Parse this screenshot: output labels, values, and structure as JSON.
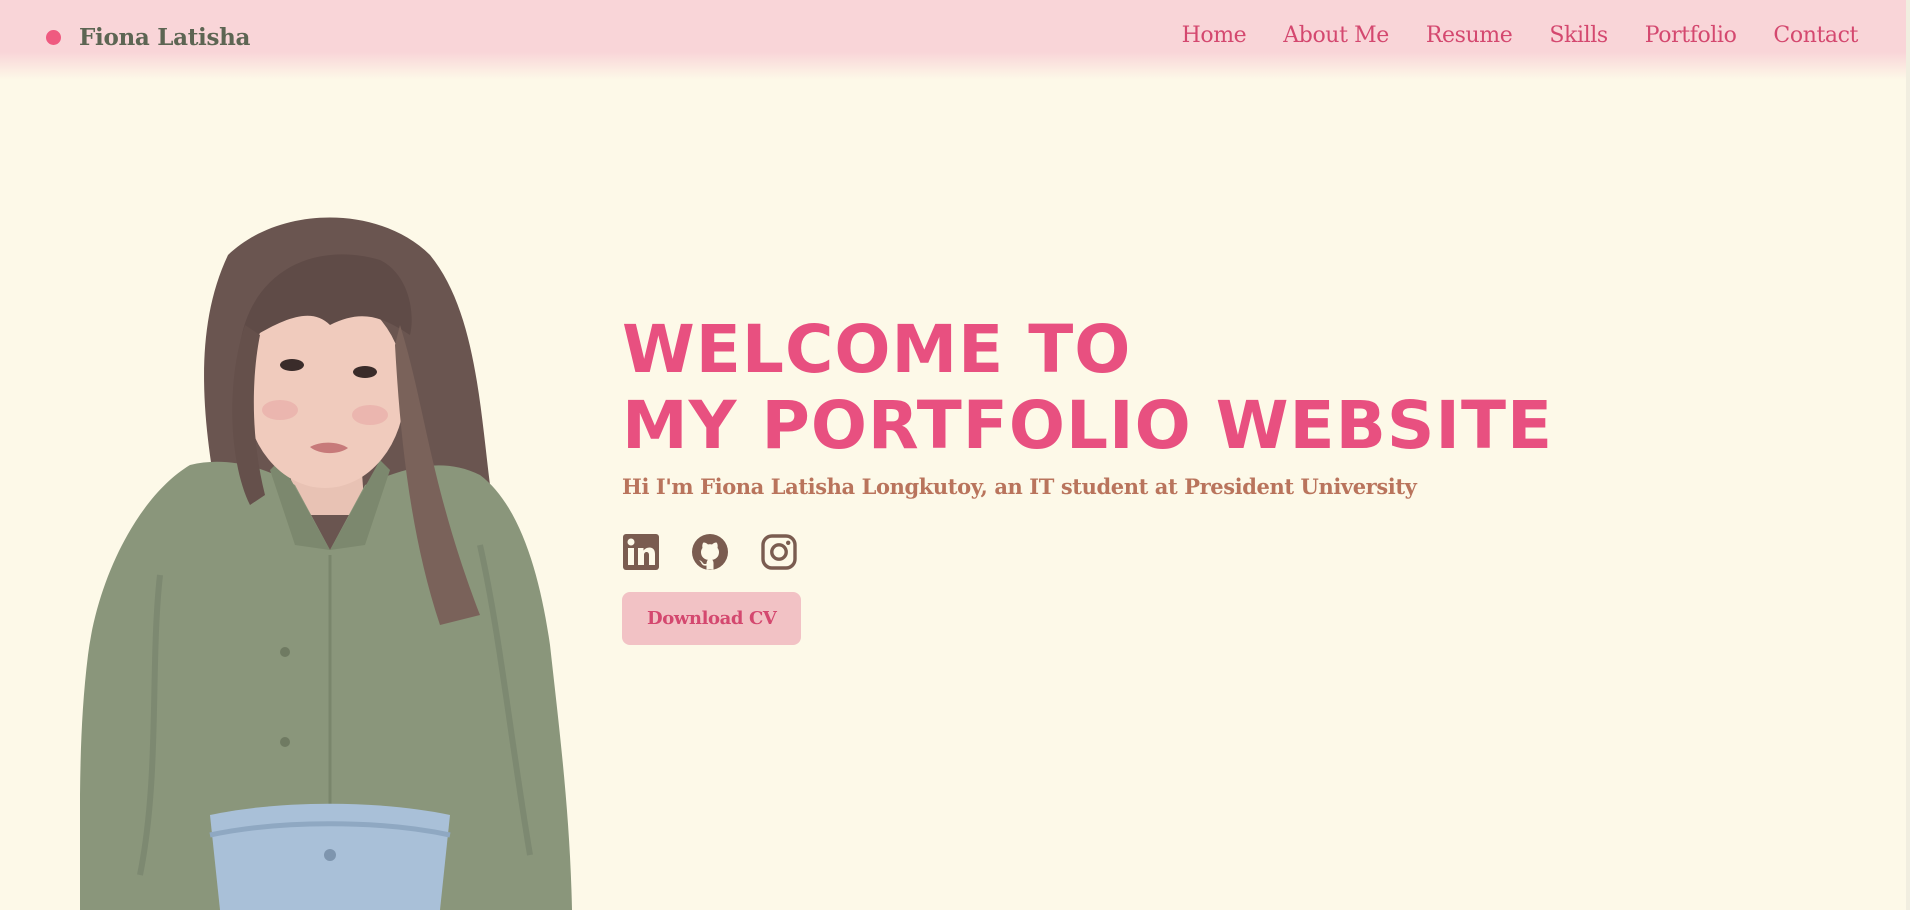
{
  "navbar": {
    "brand_name": "Fiona Latisha",
    "brand_dot_color": "#ef5a80",
    "links": [
      {
        "label": "Home"
      },
      {
        "label": "About Me"
      },
      {
        "label": "Resume"
      },
      {
        "label": "Skills"
      },
      {
        "label": "Portfolio"
      },
      {
        "label": "Contact"
      }
    ]
  },
  "hero": {
    "title_line1": "WELCOME TO",
    "title_line2": "MY PORTFOLIO WEBSITE",
    "subtitle": "Hi I'm Fiona Latisha Longkutoy, an IT student at President University",
    "socials": [
      {
        "icon": "linkedin-icon"
      },
      {
        "icon": "github-icon"
      },
      {
        "icon": "instagram-icon"
      }
    ],
    "cv_button_label": "Download CV"
  },
  "colors": {
    "background": "#fdf9e8",
    "navbar": "#f9d5d8",
    "accent_pink": "#e85080",
    "nav_link": "#d4486f",
    "subtitle": "#b9745c",
    "icon_brown": "#7a5c50",
    "button_bg": "#f2c2c5",
    "brand_text": "#5d6553"
  }
}
